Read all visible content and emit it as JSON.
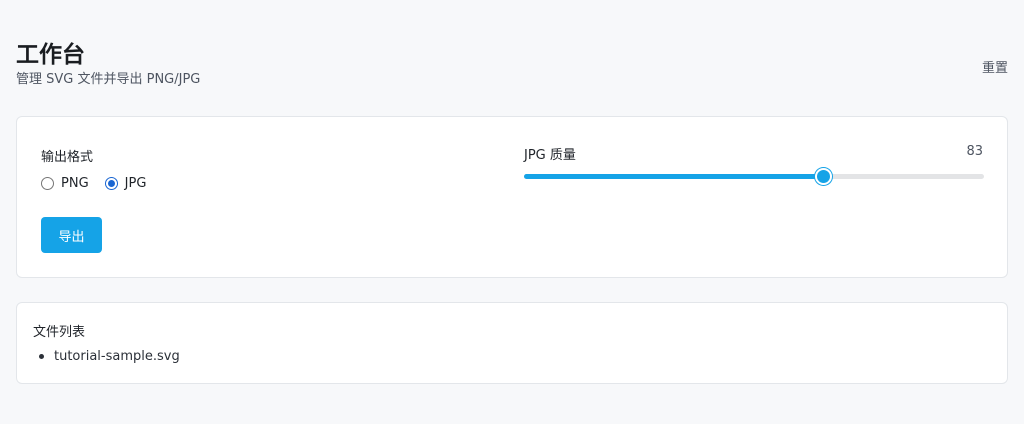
{
  "header": {
    "title": "工作台",
    "subtitle": "管理 SVG 文件并导出 PNG/JPG",
    "reset_label": "重置"
  },
  "settings": {
    "format_label": "输出格式",
    "formats": [
      {
        "label": "PNG",
        "checked": false
      },
      {
        "label": "JPG",
        "checked": true
      }
    ],
    "export_label": "导出",
    "quality_label": "JPG 质量",
    "quality_value": "83",
    "quality_fraction": 0.65
  },
  "files": {
    "title": "文件列表",
    "items": [
      "tutorial-sample.svg"
    ]
  },
  "colors": {
    "accent": "#15a3e7",
    "radio_checked": "#1a66d2",
    "background": "#f7f8fa"
  }
}
